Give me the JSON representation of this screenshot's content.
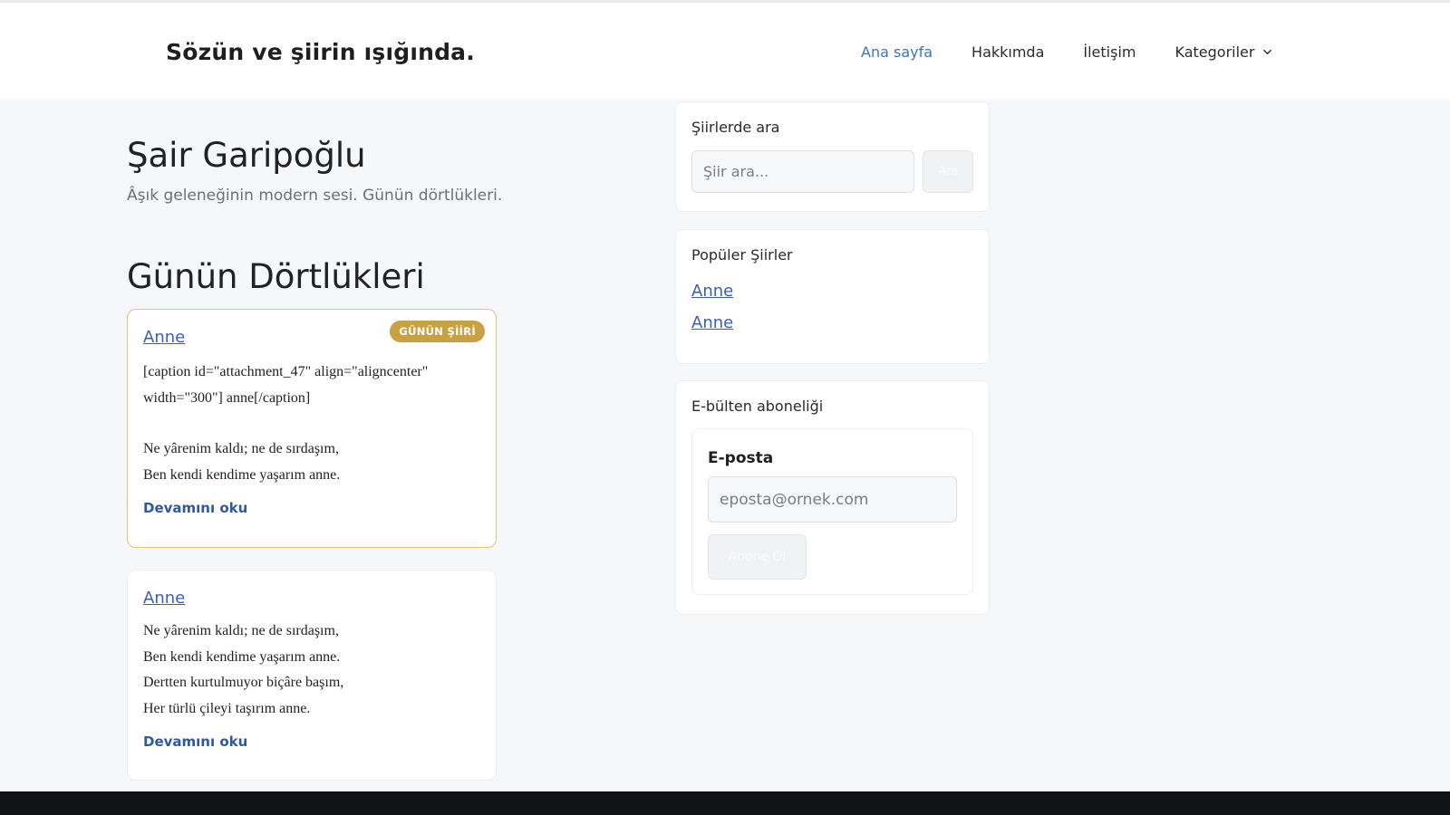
{
  "header": {
    "site_title": "Sözün ve şiirin ışığında.",
    "nav": [
      {
        "label": "Ana sayfa",
        "active": true
      },
      {
        "label": "Hakkımda",
        "active": false
      },
      {
        "label": "İletişim",
        "active": false
      },
      {
        "label": "Kategoriler",
        "active": false,
        "has_dropdown": true
      }
    ]
  },
  "hero": {
    "title": "Şair Garipoğlu",
    "subtitle": "Âşık geleneğinin modern sesi. Günün dörtlükleri."
  },
  "section": {
    "title": "Günün Dörtlükleri"
  },
  "posts": [
    {
      "title": "Anne",
      "badge": "GÜNÜN ŞİİRİ",
      "lines": [
        "[caption id=\"attachment_47\" align=\"aligncenter\"",
        "width=\"300\"] anne[/caption]",
        "",
        "Ne yârenim kaldı; ne de sırdaşım,",
        "Ben kendi kendime yaşarım anne."
      ],
      "read_more": "Devamını oku"
    },
    {
      "title": "Anne",
      "lines": [
        "Ne yârenim kaldı; ne de sırdaşım,",
        "Ben kendi kendime yaşarım anne.",
        "Dertten kurtulmuyor biçâre başım,",
        "Her türlü çileyi taşırım anne."
      ],
      "read_more": "Devamını oku"
    }
  ],
  "sidebar": {
    "search": {
      "title": "Şiirlerde ara",
      "placeholder": "Şiir ara...",
      "button": "Ara"
    },
    "popular": {
      "title": "Popüler Şiirler",
      "items": [
        "Anne",
        "Anne"
      ]
    },
    "newsletter": {
      "title": "E-bülten aboneliği",
      "label": "E-posta",
      "placeholder": "eposta@ornek.com",
      "button": "Abone Ol"
    }
  },
  "colors": {
    "accent": "#3a73c9",
    "link": "#3a5fb8",
    "badge": "#c9a042",
    "featured_border": "#e3c27a",
    "footer": "#111214"
  },
  "icons": {
    "dropdown": "chevron-down-icon"
  }
}
